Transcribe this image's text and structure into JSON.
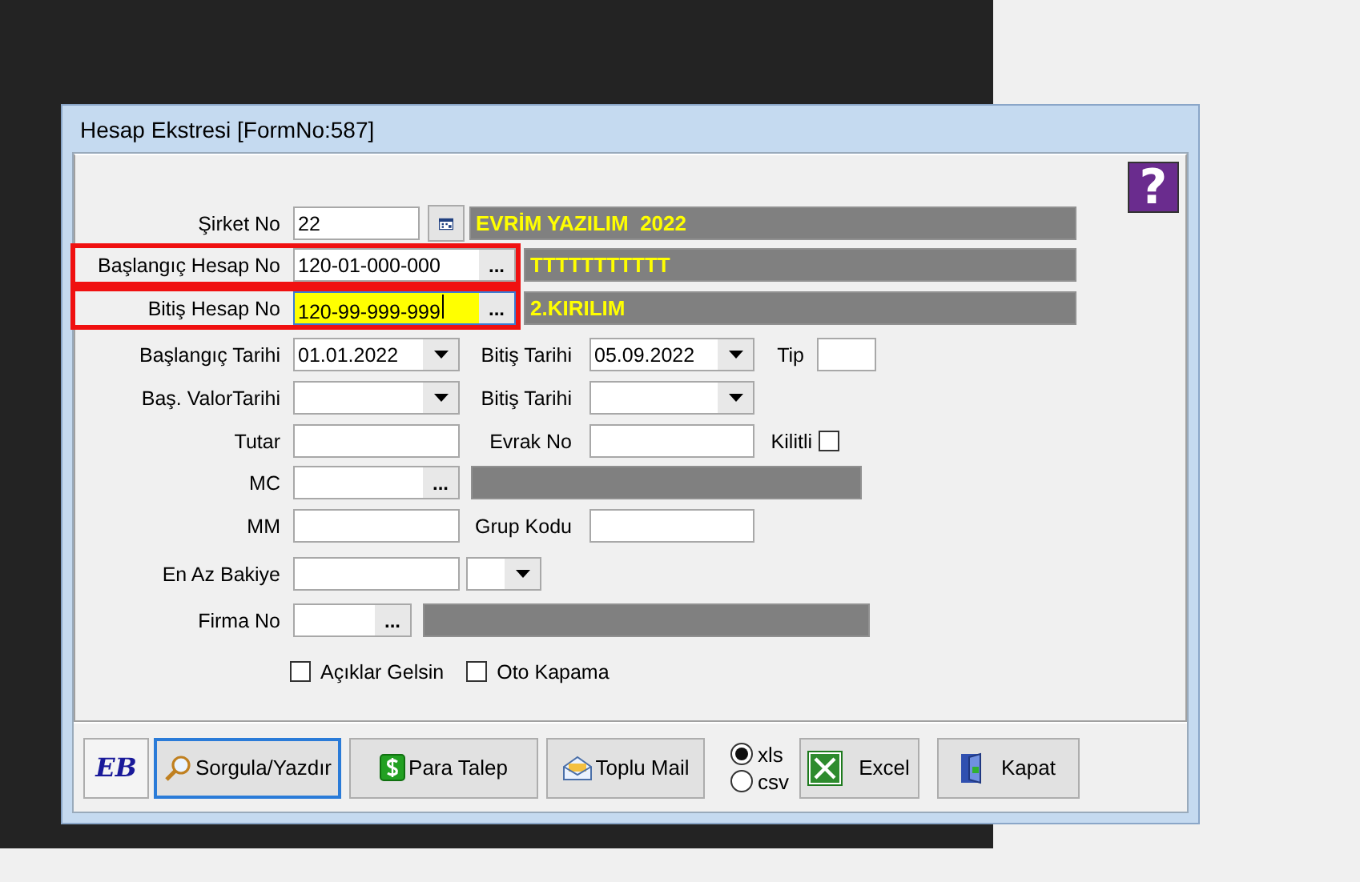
{
  "window": {
    "title": "Hesap Ekstresi [FormNo:587]"
  },
  "help": "?",
  "rows": [
    {
      "highlighted": false,
      "items": [
        {
          "kind": "label",
          "text": "Şirket No"
        },
        {
          "kind": "text",
          "value": "22",
          "focused": false
        },
        {
          "kind": "calendar"
        },
        {
          "kind": "info",
          "text": "EVRİM YAZILIM  2022"
        }
      ]
    },
    {
      "highlighted": true,
      "items": [
        {
          "kind": "label",
          "text": "Başlangıç Hesap No"
        },
        {
          "kind": "lookup",
          "value": "120-01-000-000",
          "button": "...",
          "focused": false
        },
        {
          "kind": "info",
          "text": "TTTTTTTTTTT"
        }
      ]
    },
    {
      "highlighted": true,
      "items": [
        {
          "kind": "label",
          "text": "Bitiş Hesap No"
        },
        {
          "kind": "lookup",
          "value": "120-99-999-999",
          "button": "...",
          "focused": true
        },
        {
          "kind": "info",
          "text": "2.KIRILIM"
        }
      ]
    },
    {
      "highlighted": false,
      "items": [
        {
          "kind": "label",
          "text": "Başlangıç Tarihi"
        },
        {
          "kind": "dropdown",
          "value": "01.01.2022"
        },
        {
          "kind": "label",
          "text": "Bitiş Tarihi"
        },
        {
          "kind": "dropdown",
          "value": "05.09.2022"
        },
        {
          "kind": "label",
          "text": "Tip"
        },
        {
          "kind": "text",
          "focused": false
        }
      ]
    },
    {
      "highlighted": false,
      "items": [
        {
          "kind": "label",
          "text": "Baş. ValorTarihi"
        },
        {
          "kind": "dropdown"
        },
        {
          "kind": "label",
          "text": "Bitiş Tarihi"
        },
        {
          "kind": "dropdown"
        }
      ]
    },
    {
      "highlighted": false,
      "items": [
        {
          "kind": "label",
          "text": "Tutar"
        },
        {
          "kind": "text",
          "focused": false
        },
        {
          "kind": "label",
          "text": "Evrak No"
        },
        {
          "kind": "text",
          "focused": false
        },
        {
          "kind": "label",
          "text": "Kilitli"
        },
        {
          "kind": "checkbox",
          "checked": false
        }
      ]
    },
    {
      "highlighted": false,
      "items": [
        {
          "kind": "label",
          "text": "MC"
        },
        {
          "kind": "lookup",
          "button": "...",
          "focused": false
        },
        {
          "kind": "info"
        }
      ]
    },
    {
      "highlighted": false,
      "items": [
        {
          "kind": "label",
          "text": "MM"
        },
        {
          "kind": "text",
          "focused": false
        },
        {
          "kind": "label",
          "text": "Grup Kodu"
        },
        {
          "kind": "text",
          "focused": false
        }
      ]
    },
    {
      "highlighted": false,
      "items": [
        {
          "kind": "label",
          "text": "En Az Bakiye"
        },
        {
          "kind": "text",
          "focused": false
        },
        {
          "kind": "dropdown"
        }
      ]
    },
    {
      "highlighted": false,
      "items": [
        {
          "kind": "label",
          "text": "Firma No"
        },
        {
          "kind": "lookup",
          "button": "...",
          "focused": false
        },
        {
          "kind": "info"
        }
      ]
    },
    {
      "highlighted": false,
      "items": [
        {
          "kind": "checkbox",
          "text": "Açıklar Gelsin",
          "checked": false
        },
        {
          "kind": "checkbox",
          "text": "Oto Kapama",
          "checked": false
        }
      ]
    }
  ],
  "toolbar": [
    {
      "kind": "logo",
      "text": "EB",
      "focused": false
    },
    {
      "kind": "button",
      "label": "Sorgula/Yazdır",
      "focused": true
    },
    {
      "kind": "button",
      "label": "Para Talep",
      "focused": false
    },
    {
      "kind": "button",
      "label": "Toplu Mail",
      "focused": false
    },
    {
      "kind": "radio",
      "options": [
        {
          "label": "xls",
          "selected": true
        },
        {
          "label": "csv",
          "selected": false
        }
      ]
    },
    {
      "kind": "button",
      "label": "Excel",
      "focused": false
    },
    {
      "kind": "button",
      "label": "Kapat",
      "focused": false
    }
  ]
}
